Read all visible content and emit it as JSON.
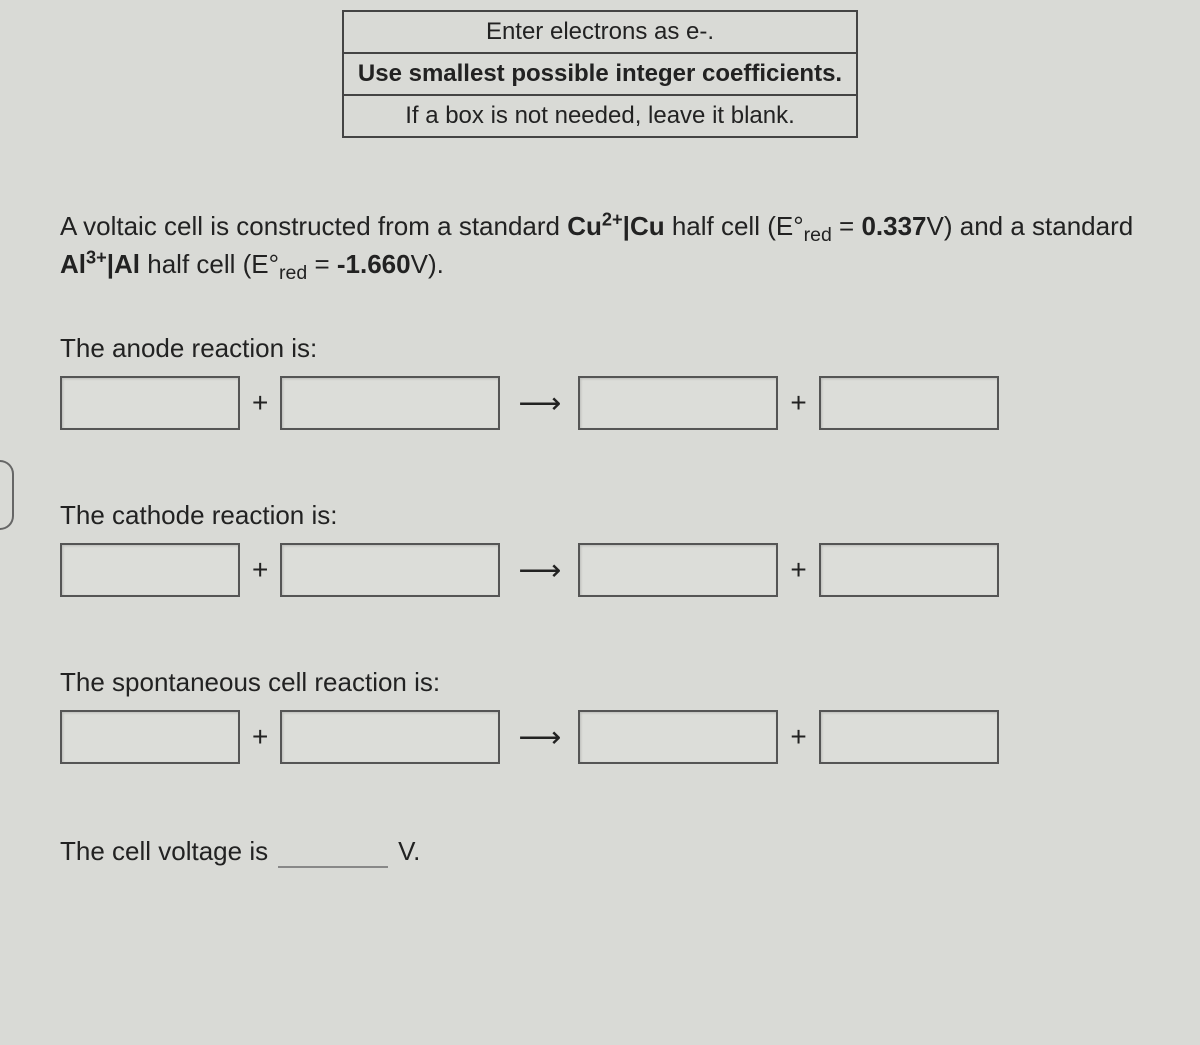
{
  "instructions": {
    "row1": "Enter electrons as e‑.",
    "row2": "Use smallest possible integer coefficients.",
    "row3": "If a box is not needed, leave it blank."
  },
  "problem": {
    "prefix": "A voltaic cell is constructed from a standard ",
    "cu_species": "Cu",
    "cu_charge": "2+",
    "pipe": "|",
    "cu_metal": "Cu",
    "half_cell_text": " half cell (E°",
    "red_sub": "red",
    "eq1": " = ",
    "cu_value": "0.337",
    "v_and_std": "V) and a standard ",
    "al_species": "Al",
    "al_charge": "3+",
    "al_metal": "Al",
    "eq2": " = ",
    "al_value": "-1.660",
    "v_close": "V)."
  },
  "sections": {
    "anode": "The anode reaction is:",
    "cathode": "The cathode reaction is:",
    "spontaneous": "The spontaneous cell reaction is:",
    "voltage_prefix": "The cell voltage is",
    "voltage_unit": "V."
  },
  "ops": {
    "plus": "+",
    "arrow": "→"
  },
  "inputs": {
    "anode": {
      "b1": "",
      "b2": "",
      "b3": "",
      "b4": ""
    },
    "cathode": {
      "b1": "",
      "b2": "",
      "b3": "",
      "b4": ""
    },
    "spont": {
      "b1": "",
      "b2": "",
      "b3": "",
      "b4": ""
    },
    "voltage": ""
  }
}
